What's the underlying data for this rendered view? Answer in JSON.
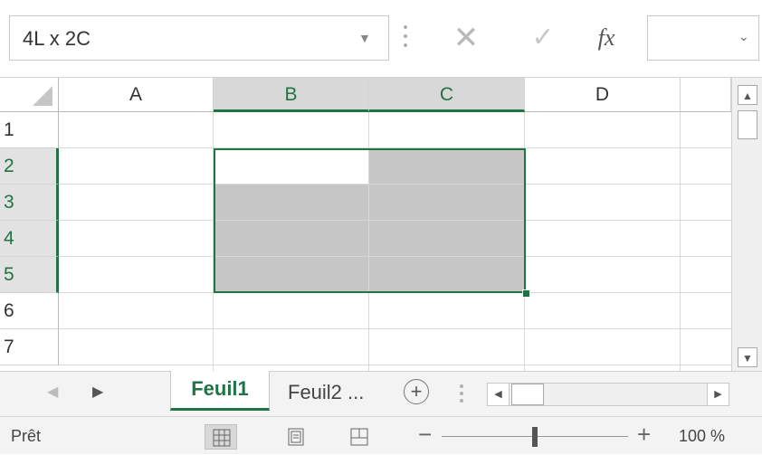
{
  "formula_bar": {
    "name_box_value": "4L x 2C",
    "cancel_glyph": "✕",
    "enter_glyph": "✓",
    "fx_label": "fx",
    "formula_value": ""
  },
  "grid": {
    "columns": [
      "A",
      "B",
      "C",
      "D"
    ],
    "selected_columns": [
      "B",
      "C"
    ],
    "rows": [
      "1",
      "2",
      "3",
      "4",
      "5",
      "6",
      "7"
    ],
    "selected_rows": [
      "2",
      "3",
      "4",
      "5"
    ],
    "selection_color": "#c6c6c6",
    "accent_color": "#217346"
  },
  "sheet_tabs": {
    "tabs": [
      {
        "label": "Feuil1",
        "active": true
      },
      {
        "label": "Feuil2 ...",
        "active": false
      }
    ],
    "add_label": "+"
  },
  "status_bar": {
    "status": "Prêt",
    "zoom_out_label": "−",
    "zoom_in_label": "+",
    "zoom_level": "100 %",
    "zoom_fraction": 0.5
  }
}
